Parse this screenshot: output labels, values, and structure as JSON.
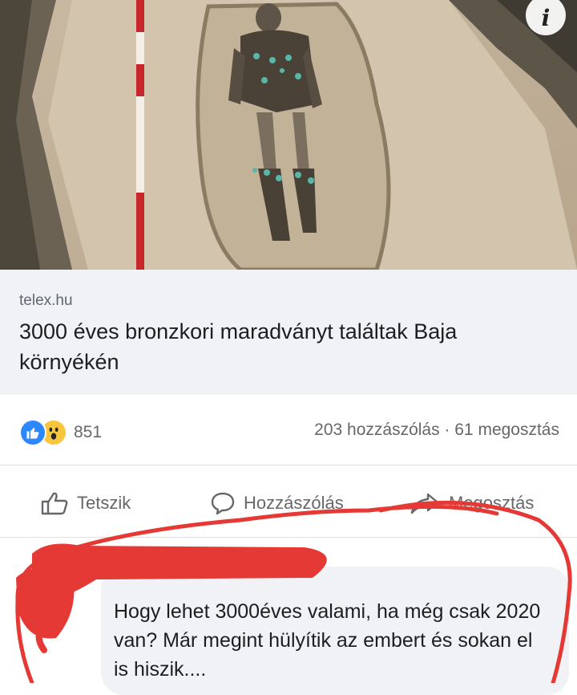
{
  "post": {
    "image_alt": "Excavated bronze age skeleton in grave with measuring pole",
    "info_icon": "i",
    "link": {
      "domain": "telex.hu",
      "headline": "3000 éves bronzkori maradványt találtak Baja környékén"
    },
    "reactions": {
      "icons": [
        "like-reaction-icon",
        "wow-reaction-icon"
      ],
      "count": "851"
    },
    "stats": {
      "summary": "203 hozzászólás · 61 megosztás"
    },
    "actions": [
      {
        "label": "Tetszik",
        "icon": "thumbs-up-icon"
      },
      {
        "label": "Hozzászólás",
        "icon": "comment-icon"
      },
      {
        "label": "Megosztás",
        "icon": "share-icon"
      }
    ]
  },
  "comment": {
    "text": "Hogy lehet 3000éves valami, ha még csak 2020 van? Már megint hülyítik az embert és sokan el is hiszik...."
  },
  "colors": {
    "accent_blue": "#2d88ff",
    "wow_yellow": "#f7c53e",
    "marker_red": "#e53935",
    "secondary_text": "#65676b",
    "bubble_bg": "#f0f2f5"
  }
}
